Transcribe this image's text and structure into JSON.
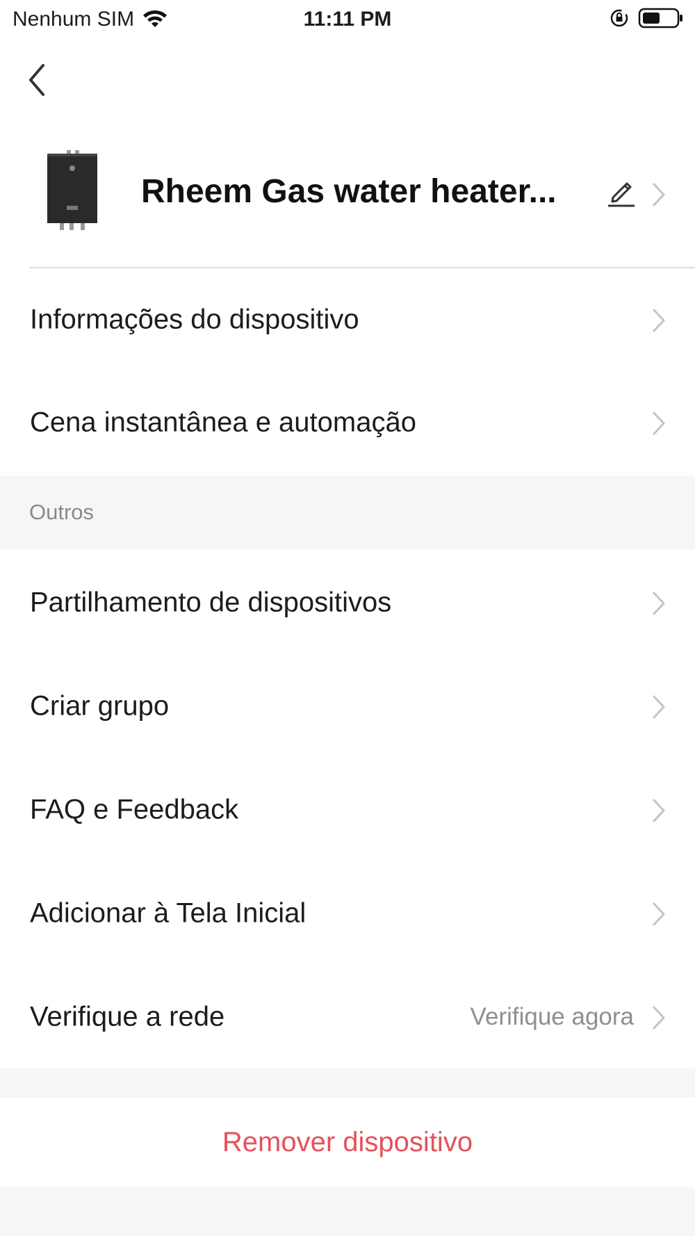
{
  "status_bar": {
    "carrier": "Nenhum SIM",
    "time": "11:11 PM",
    "icons": [
      "wifi-icon",
      "orientation-lock-icon",
      "battery-icon"
    ]
  },
  "nav": {
    "back_icon": "chevron-left-icon"
  },
  "device": {
    "name": "Rheem Gas water heater...",
    "thumbnail": "water-heater-image",
    "edit_icon": "pencil-icon"
  },
  "menu": {
    "device_info": "Informações do dispositivo",
    "scene_automation": "Cena instantânea e automação"
  },
  "others": {
    "section_title": "Outros",
    "share": "Partilhamento de dispositivos",
    "create_group": "Criar grupo",
    "faq": "FAQ e Feedback",
    "add_home": "Adicionar à Tela Inicial",
    "network": "Verifique a rede",
    "network_action": "Verifique agora"
  },
  "remove": {
    "label": "Remover dispositivo"
  },
  "colors": {
    "remove_text": "#e4525a",
    "section_bg": "#f6f6f6",
    "secondary_text": "#8e8e93"
  }
}
